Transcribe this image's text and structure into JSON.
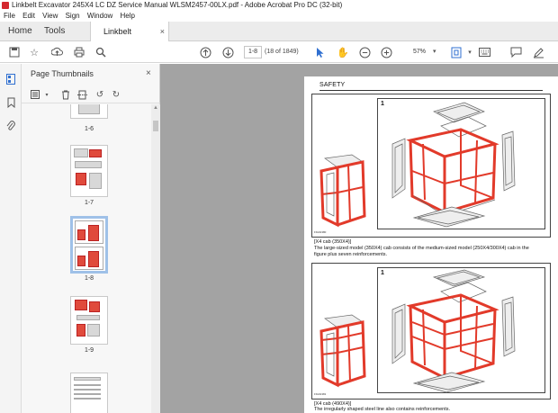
{
  "window": {
    "title": "Linkbelt Excavator 245X4 LC DZ Service Manual WLSM2457-00LX.pdf - Adobe Acrobat Pro DC (32-bit)"
  },
  "menu": [
    "File",
    "Edit",
    "View",
    "Sign",
    "Window",
    "Help"
  ],
  "tabs": {
    "home": "Home",
    "tools": "Tools",
    "document": "Linkbelt Excavator ...",
    "close": "×"
  },
  "toolbar": {
    "page_value": "1-8",
    "page_of": "(18 of 1849)",
    "zoom": "57%",
    "icons": [
      "bookmark-star-icon",
      "upload-icon",
      "print-icon",
      "search-icon",
      "arrow-up-icon",
      "arrow-down-icon",
      "select-cursor-icon",
      "hand-icon",
      "zoom-out-icon",
      "zoom-in-icon",
      "fit-page-icon",
      "keyboard-icon",
      "comment-icon",
      "sign-icon"
    ]
  },
  "panel": {
    "title": "Page Thumbnails",
    "close": "×",
    "thumbnails": [
      {
        "label": "1-6",
        "selected": false
      },
      {
        "label": "1-7",
        "selected": false
      },
      {
        "label": "1-8",
        "selected": true
      },
      {
        "label": "1-9",
        "selected": false
      }
    ]
  },
  "page": {
    "heading": "SAFETY",
    "figures": [
      {
        "number": "1",
        "code": "FIG91380",
        "caption_title": "[X4 cab (350X4)]",
        "caption_text": "The large-sized model (350X4) cab consists of the medium-sized model (250X4/300X4) cab in the figure plus seven reinforcements."
      },
      {
        "number": "1",
        "code": "FIG91381",
        "caption_title": "[X4 cab (490X4)]",
        "caption_text": "The irregularly shaped steel line also contains reinforcements."
      }
    ]
  },
  "colors": {
    "accent": "#2f6fd0",
    "doc_background": "#a3a3a3",
    "cab_highlight": "#e23a2a"
  }
}
